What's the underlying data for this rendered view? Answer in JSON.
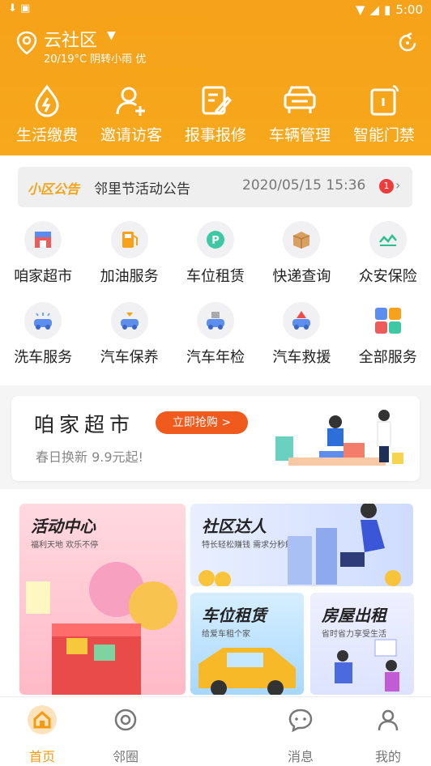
{
  "status_bar": {
    "time": "5:00"
  },
  "header": {
    "community": "云社区",
    "weather": "20/19°C 阴转小雨 优",
    "quick_actions": [
      {
        "label": "生活缴费",
        "icon": "bill-drop-icon"
      },
      {
        "label": "邀请访客",
        "icon": "invite-user-icon"
      },
      {
        "label": "报事报修",
        "icon": "repair-icon"
      },
      {
        "label": "车辆管理",
        "icon": "car-icon"
      },
      {
        "label": "智能门禁",
        "icon": "door-access-icon"
      }
    ]
  },
  "notice": {
    "tag": "小区公告",
    "text": "邻里节活动公告",
    "date": "2020/05/15 15:36",
    "badge": "1"
  },
  "services": [
    {
      "label": "咱家超市",
      "icon": "supermarket-icon"
    },
    {
      "label": "加油服务",
      "icon": "fuel-icon"
    },
    {
      "label": "车位租赁",
      "icon": "parking-icon"
    },
    {
      "label": "快递查询",
      "icon": "package-icon"
    },
    {
      "label": "众安保险",
      "icon": "insurance-icon"
    },
    {
      "label": "洗车服务",
      "icon": "car-wash-icon"
    },
    {
      "label": "汽车保养",
      "icon": "car-maintenance-icon"
    },
    {
      "label": "汽车年检",
      "icon": "car-inspection-icon"
    },
    {
      "label": "汽车救援",
      "icon": "car-rescue-icon"
    },
    {
      "label": "全部服务",
      "icon": "all-services-icon"
    }
  ],
  "banner": {
    "title": "咱家超市",
    "button": "立即抢购 >",
    "subtitle": "春日换新 9.9元起!"
  },
  "promos": [
    {
      "title": "活动中心",
      "subtitle": "福利天地 欢乐不停"
    },
    {
      "title": "社区达人",
      "subtitle": "特长轻松赚钱 需求分秒解决"
    },
    {
      "title": "车位租赁",
      "subtitle": "给爱车租个家"
    },
    {
      "title": "房屋出租",
      "subtitle": "省时省力享受生活"
    }
  ],
  "tabbar": [
    {
      "label": "首页",
      "icon": "home-icon",
      "active": true
    },
    {
      "label": "邻圈",
      "icon": "circle-icon",
      "active": false
    },
    {
      "label": "消息",
      "icon": "message-icon",
      "active": false
    },
    {
      "label": "我的",
      "icon": "profile-icon",
      "active": false
    }
  ],
  "colors": {
    "accent": "#f6a21a",
    "badge": "#ee3b3b",
    "button": "#f05a1c"
  }
}
